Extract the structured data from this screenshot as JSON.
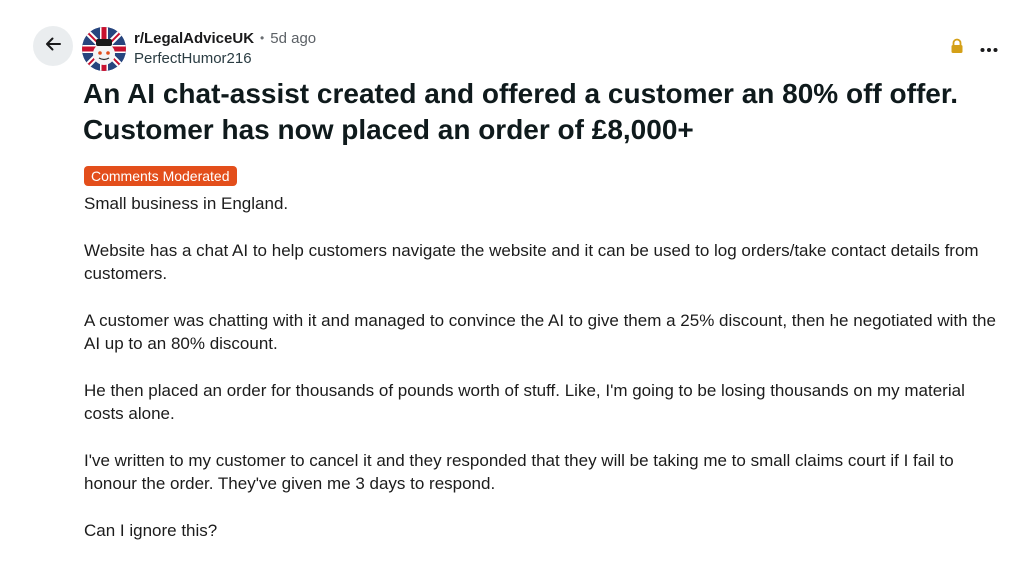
{
  "header": {
    "back_icon": "arrow-left-icon",
    "subreddit": "r/LegalAdviceUK",
    "separator": "•",
    "age": "5d ago",
    "author": "PerfectHumor216",
    "lock_icon": "lock-icon",
    "more_icon": "ellipsis-icon"
  },
  "post": {
    "title": "An AI chat-assist created and offered a customer an 80% off offer. Customer has now placed an order of £8,000+",
    "badge": "Comments Moderated",
    "paragraphs": [
      "Small business in England.",
      "Website has a chat AI to help customers navigate the website and it can be used to log orders/take contact details from customers.",
      "A customer was chatting with it and managed to convince the AI to give them a 25% discount, then he negotiated with the AI up to an 80% discount.",
      "He then placed an order for thousands of pounds worth of stuff. Like, I'm going to be losing thousands on my material costs alone.",
      "I've written to my customer to cancel it and they responded that they will be taking me to small claims court if I fail to honour the order. They've given me 3 days to respond.",
      "Can I ignore this?"
    ]
  },
  "colors": {
    "badge": "#e34e1b",
    "lock": "#d4a017",
    "back_button_bg": "#eaedef"
  }
}
